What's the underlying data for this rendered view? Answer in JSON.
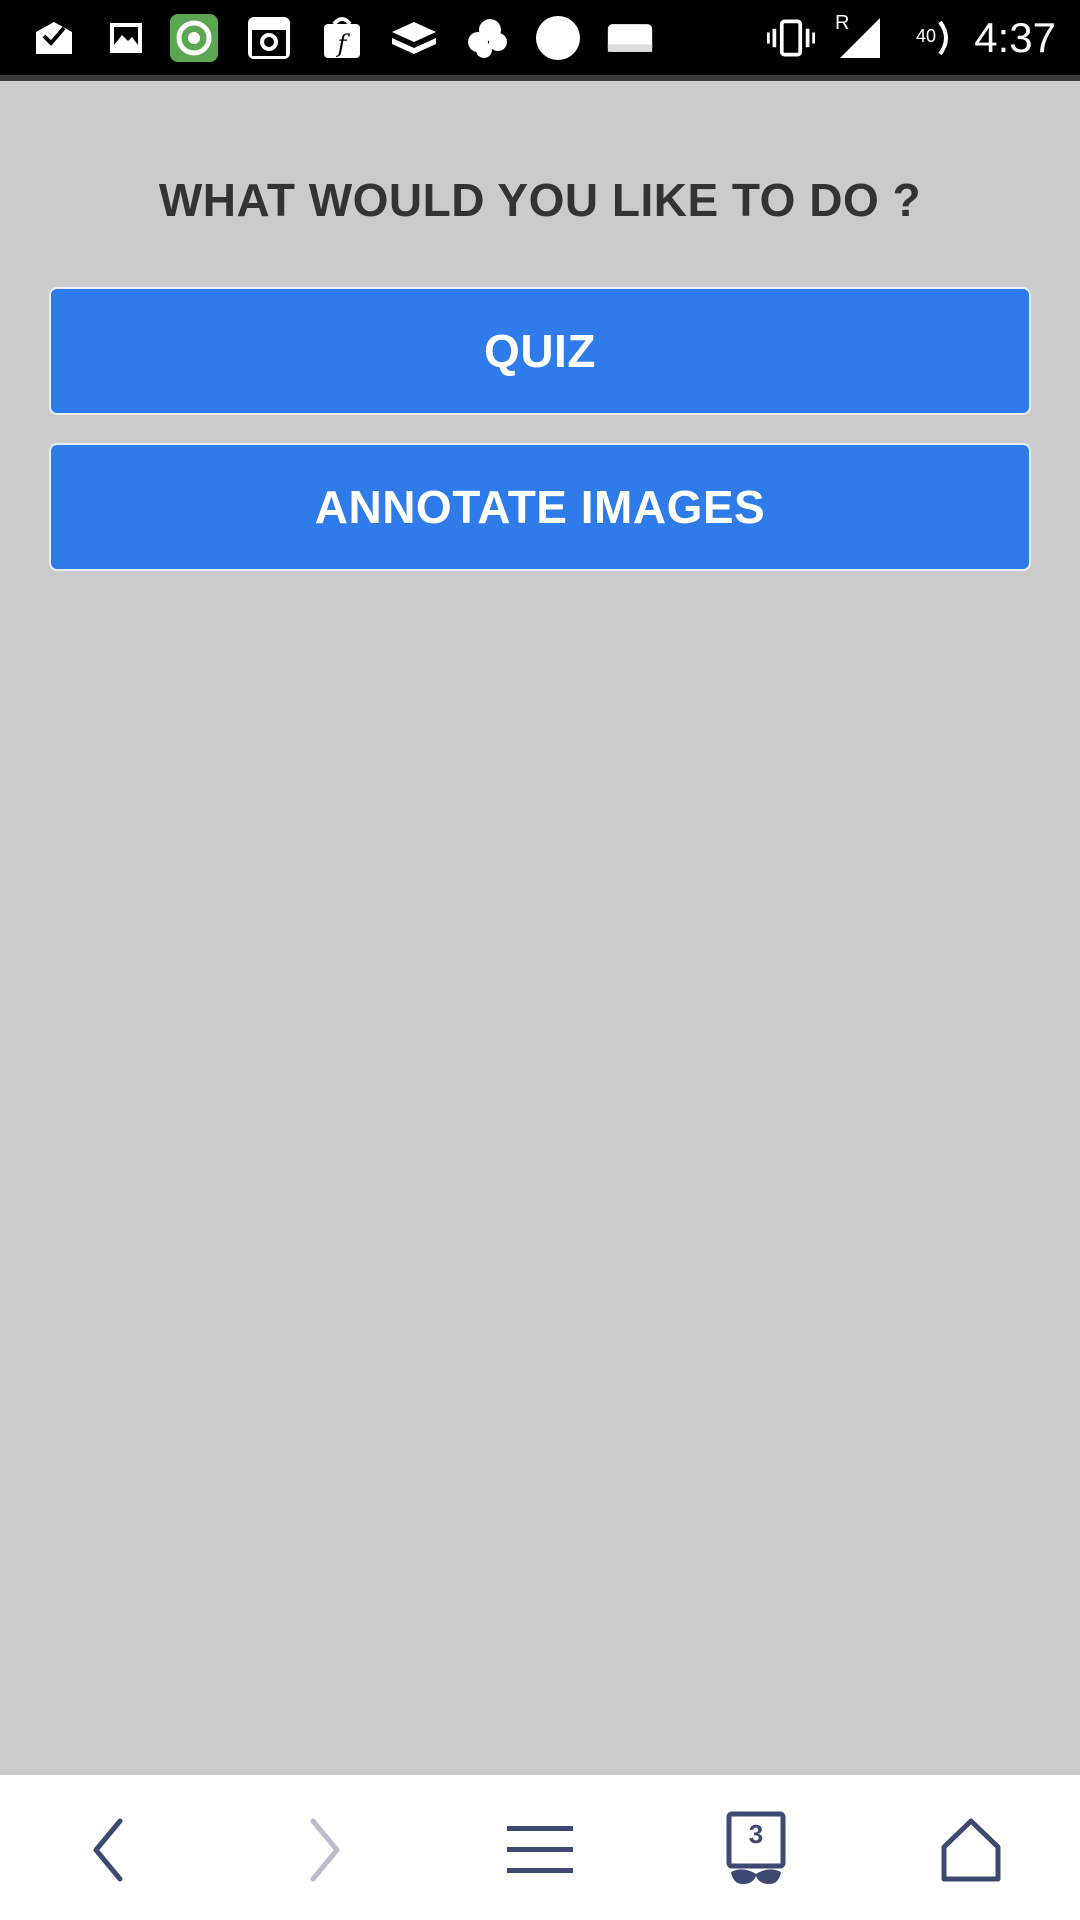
{
  "status_bar": {
    "time": "4:37",
    "network_badge": "R",
    "volume_badge": "40",
    "icons": [
      "mail-check-icon",
      "image-icon",
      "app-green-icon",
      "instagram-icon",
      "shop-icon",
      "dropbox-icon",
      "cloud-icon",
      "circle-icon",
      "card-icon",
      "vibrate-icon",
      "signal-icon",
      "volume-icon"
    ]
  },
  "main": {
    "heading": "WHAT WOULD YOU LIKE TO DO  ?",
    "buttons": {
      "quiz": "QUIZ",
      "annotate": "ANNOTATE IMAGES"
    }
  },
  "nav": {
    "tabs_count": "3",
    "icons": [
      "back-icon",
      "forward-icon",
      "menu-icon",
      "tabs-icon",
      "home-icon"
    ]
  },
  "colors": {
    "background": "#cbcbcb",
    "button": "#2f7be9",
    "heading": "#333333",
    "nav_icon": "#3c4a72"
  }
}
